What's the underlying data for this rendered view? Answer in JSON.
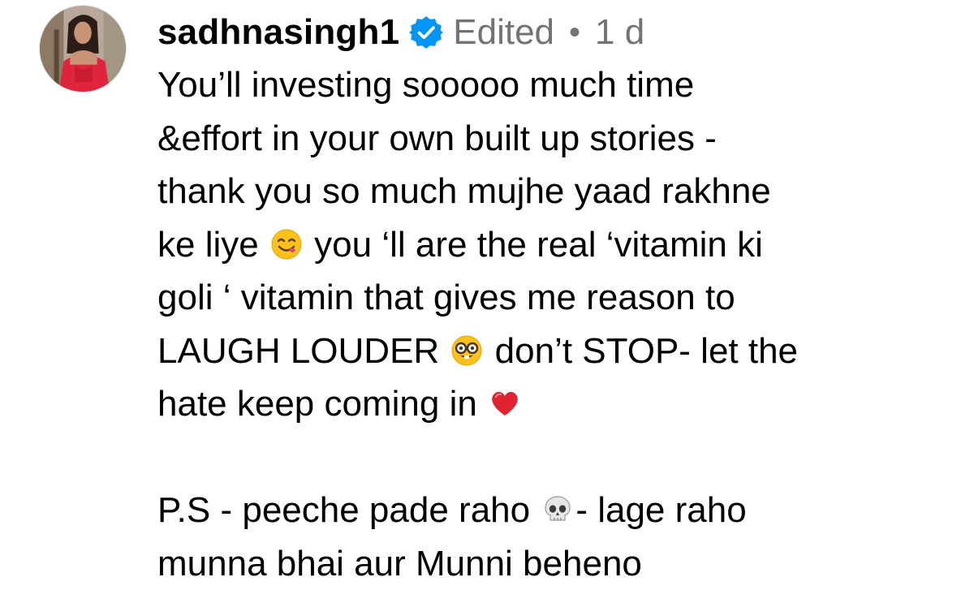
{
  "comment": {
    "username": "sadhnasingh1",
    "edited_label": "Edited",
    "separator": "•",
    "timestamp": "1 d",
    "lines": [
      "You’ll investing sooooo much time",
      "&effort in your own built up stories -",
      "thank you so much mujhe yaad rakhne",
      "ke liye ",
      " you ‘ll are the real ‘vitamin ki",
      "goli ‘ vitamin that gives me reason to",
      "LAUGH LOUDER ",
      " don’t STOP- let the",
      "hate keep coming in ",
      "P.S - peeche pade raho ",
      "- lage raho",
      "munna bhai aur Munni beheno"
    ],
    "icons": {
      "avatar": "profile-photo",
      "verified": "verified-badge-icon",
      "emoji_1": "face-savoring-food-emoji",
      "emoji_2": "nerd-face-emoji",
      "emoji_3": "red-heart-emoji",
      "emoji_4": "skull-emoji"
    }
  },
  "colors": {
    "text": "#000000",
    "meta": "#737373",
    "verified_blue": "#0095f6",
    "heart_red": "#e0242f"
  }
}
